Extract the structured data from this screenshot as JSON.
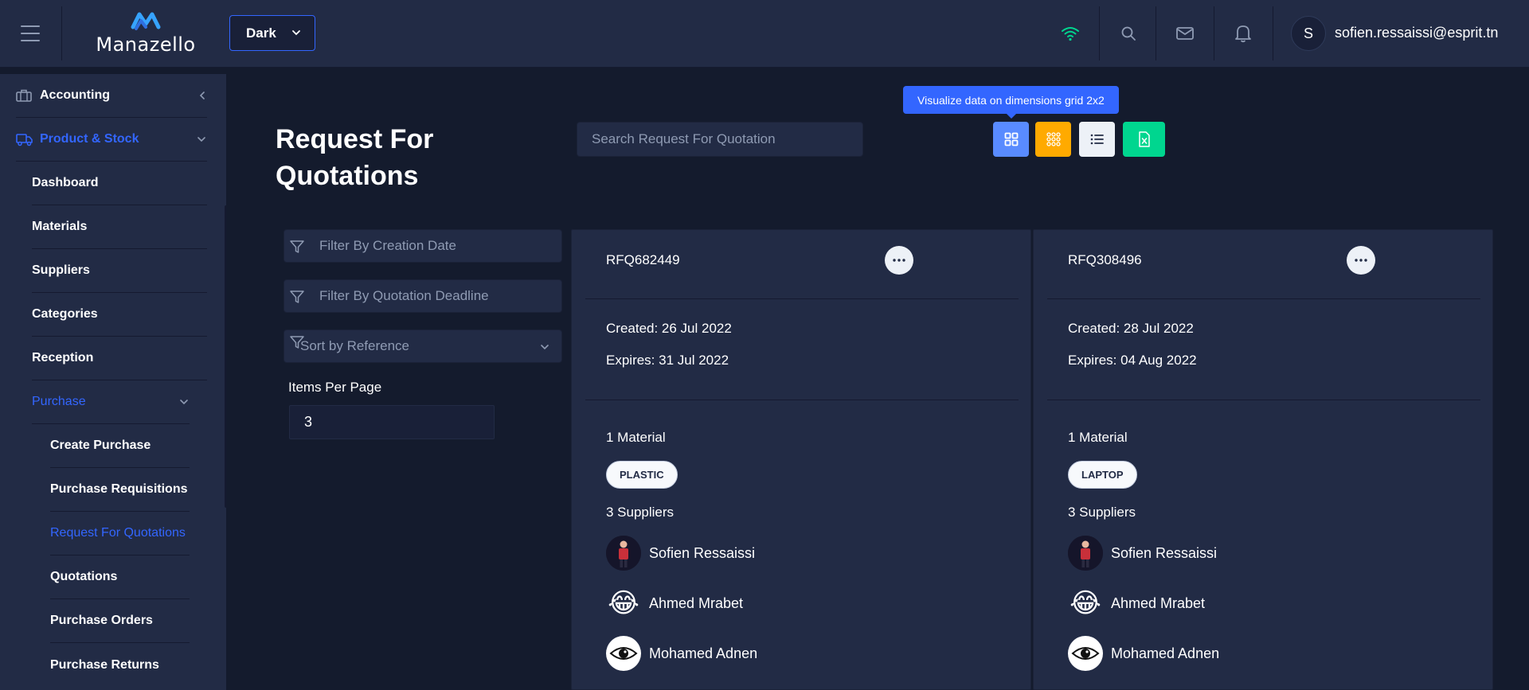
{
  "header": {
    "logo_text": "Manazello",
    "theme_value": "Dark",
    "user_initial": "S",
    "user_email": "sofien.ressaissi@esprit.tn"
  },
  "sidebar": {
    "accounting": "Accounting",
    "product_stock": "Product & Stock",
    "items": [
      {
        "label": "Dashboard"
      },
      {
        "label": "Materials"
      },
      {
        "label": "Suppliers"
      },
      {
        "label": "Categories"
      },
      {
        "label": "Reception"
      }
    ],
    "purchase": "Purchase",
    "purchase_items": [
      {
        "label": "Create Purchase"
      },
      {
        "label": "Purchase Requisitions"
      },
      {
        "label": "Request For Quotations"
      },
      {
        "label": "Quotations"
      },
      {
        "label": "Purchase Orders"
      },
      {
        "label": "Purchase Returns"
      }
    ]
  },
  "main": {
    "title": "Request For Quotations",
    "search_placeholder": "Search Request For Quotation",
    "tooltip": "Visualize data on dimensions grid 2x2",
    "filters": {
      "creation_date_placeholder": "Filter By Creation Date",
      "deadline_placeholder": "Filter By Quotation Deadline",
      "sort_value": "Sort by Reference",
      "items_per_page_label": "Items Per Page",
      "items_per_page_value": "3"
    }
  },
  "cards": [
    {
      "ref": "RFQ682449",
      "created": "Created: 26 Jul 2022",
      "expires": "Expires: 31 Jul 2022",
      "materials_count": "1 Material",
      "material_badge": "PLASTIC",
      "suppliers_count": "3 Suppliers",
      "suppliers": [
        {
          "name": "Sofien Ressaissi"
        },
        {
          "name": "Ahmed Mrabet"
        },
        {
          "name": "Mohamed Adnen"
        }
      ]
    },
    {
      "ref": "RFQ308496",
      "created": "Created: 28 Jul 2022",
      "expires": "Expires: 04 Aug 2022",
      "materials_count": "1 Material",
      "material_badge": "LAPTOP",
      "suppliers_count": "3 Suppliers",
      "suppliers": [
        {
          "name": "Sofien Ressaissi"
        },
        {
          "name": "Ahmed Mrabet"
        },
        {
          "name": "Mohamed Adnen"
        }
      ]
    }
  ],
  "colors": {
    "accent": "#3366ff",
    "background": "#141b2d",
    "panel": "#222b45",
    "grid_small_button": "#ffaa00",
    "excel_button": "#00d68f",
    "wifi": "#00d68f"
  }
}
